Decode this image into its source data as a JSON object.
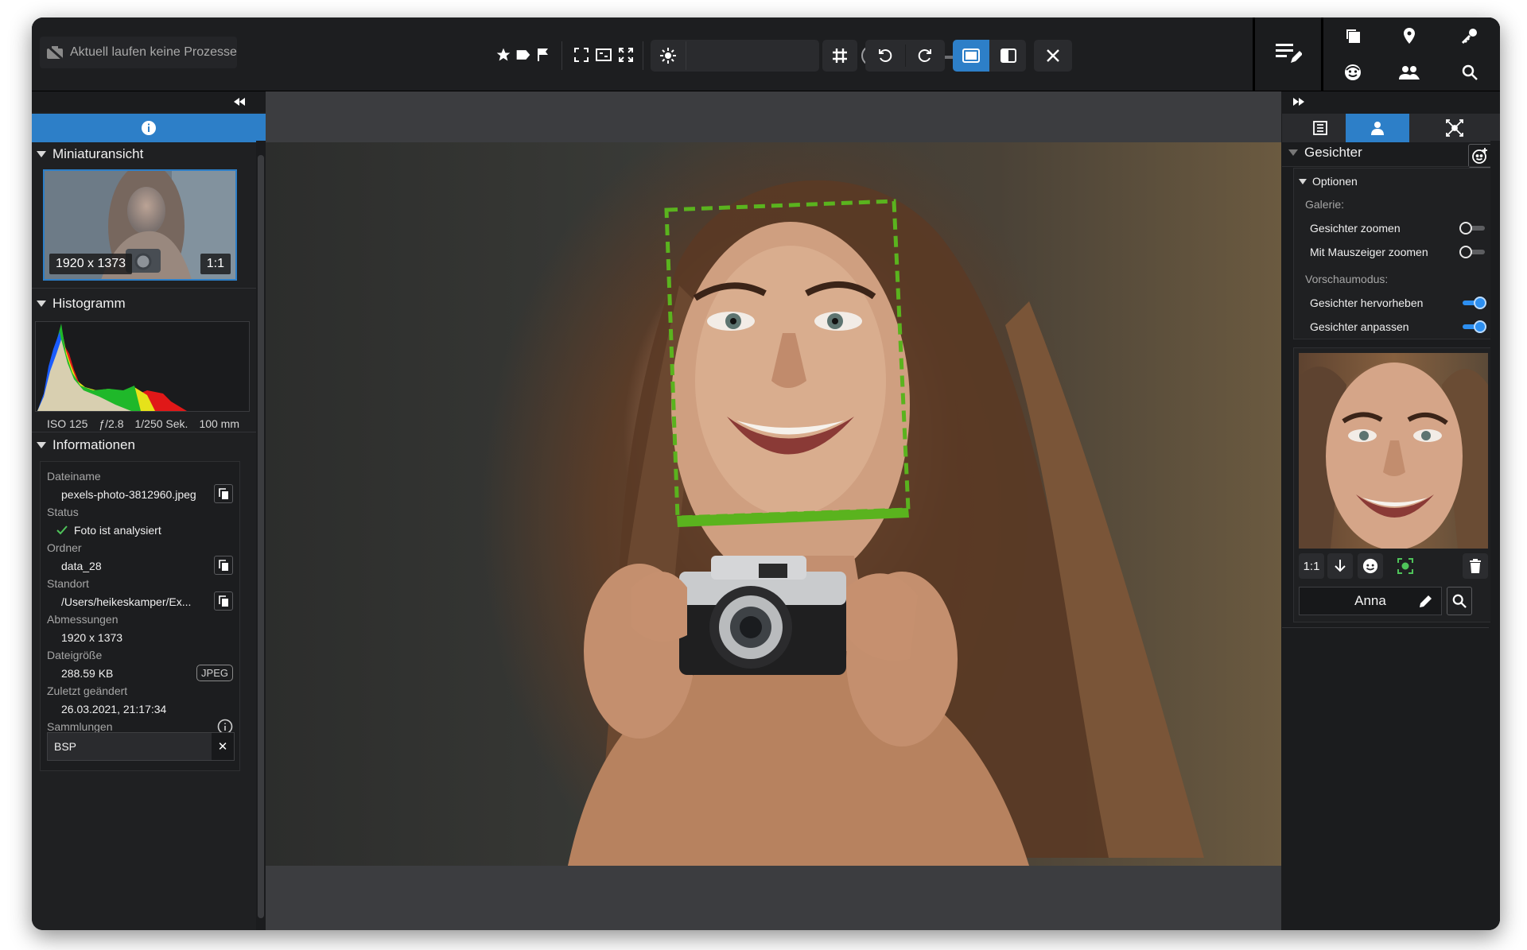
{
  "toolbar": {
    "process_status": "Aktuell laufen keine Prozesse"
  },
  "left_panel": {
    "thumbnail": {
      "title": "Miniaturansicht",
      "dimensions": "1920 x 1373",
      "ratio": "1:1"
    },
    "histogram": {
      "title": "Histogramm",
      "iso": "ISO 125",
      "aperture": "ƒ/2.8",
      "shutter": "1/250 Sek.",
      "focal": "100 mm"
    },
    "info": {
      "title": "Informationen",
      "filename_label": "Dateiname",
      "filename": "pexels-photo-3812960.jpeg",
      "status_label": "Status",
      "status": "Foto ist analysiert",
      "folder_label": "Ordner",
      "folder": "data_28",
      "location_label": "Standort",
      "location": "/Users/heikeskamper/Ex...",
      "dimensions_label": "Abmessungen",
      "dimensions": "1920 x 1373",
      "filesize_label": "Dateigröße",
      "filesize": "288.59 KB",
      "filetype": "JPEG",
      "modified_label": "Zuletzt geändert",
      "modified": "26.03.2021, 21:17:34",
      "collections_label": "Sammlungen",
      "collection_tag": "BSP"
    }
  },
  "right_panel": {
    "faces_title": "Gesichter",
    "options": {
      "title": "Optionen",
      "gallery_label": "Galerie:",
      "zoom_faces": "Gesichter zoomen",
      "zoom_faces_on": false,
      "zoom_pointer": "Mit Mauszeiger zoomen",
      "zoom_pointer_on": false,
      "preview_label": "Vorschaumodus:",
      "highlight_faces": "Gesichter hervorheben",
      "highlight_faces_on": true,
      "fit_faces": "Gesichter anpassen",
      "fit_faces_on": true
    },
    "face_card": {
      "ratio": "1:1",
      "name": "Anna"
    }
  },
  "colors": {
    "accent": "#2d7fc8",
    "face_frame": "#5ab31e",
    "toggle_on": "#2d8ff0"
  },
  "icons": [
    "no-camera-icon",
    "star-icon",
    "tag-icon",
    "flag-icon",
    "fit-icon",
    "fullscreen-icon",
    "expand-icon",
    "brightness-icon",
    "grid-icon",
    "rotate-left-icon",
    "rotate-right-icon",
    "single-view-icon",
    "compare-view-icon",
    "close-icon",
    "edit-list-icon",
    "copy-icon",
    "location-icon",
    "key-icon",
    "face-icon",
    "people-icon",
    "search-icon",
    "info-icon",
    "list-icon",
    "person-icon",
    "network-icon",
    "add-face-icon",
    "download-icon",
    "trash-icon",
    "pencil-icon",
    "check-icon"
  ]
}
